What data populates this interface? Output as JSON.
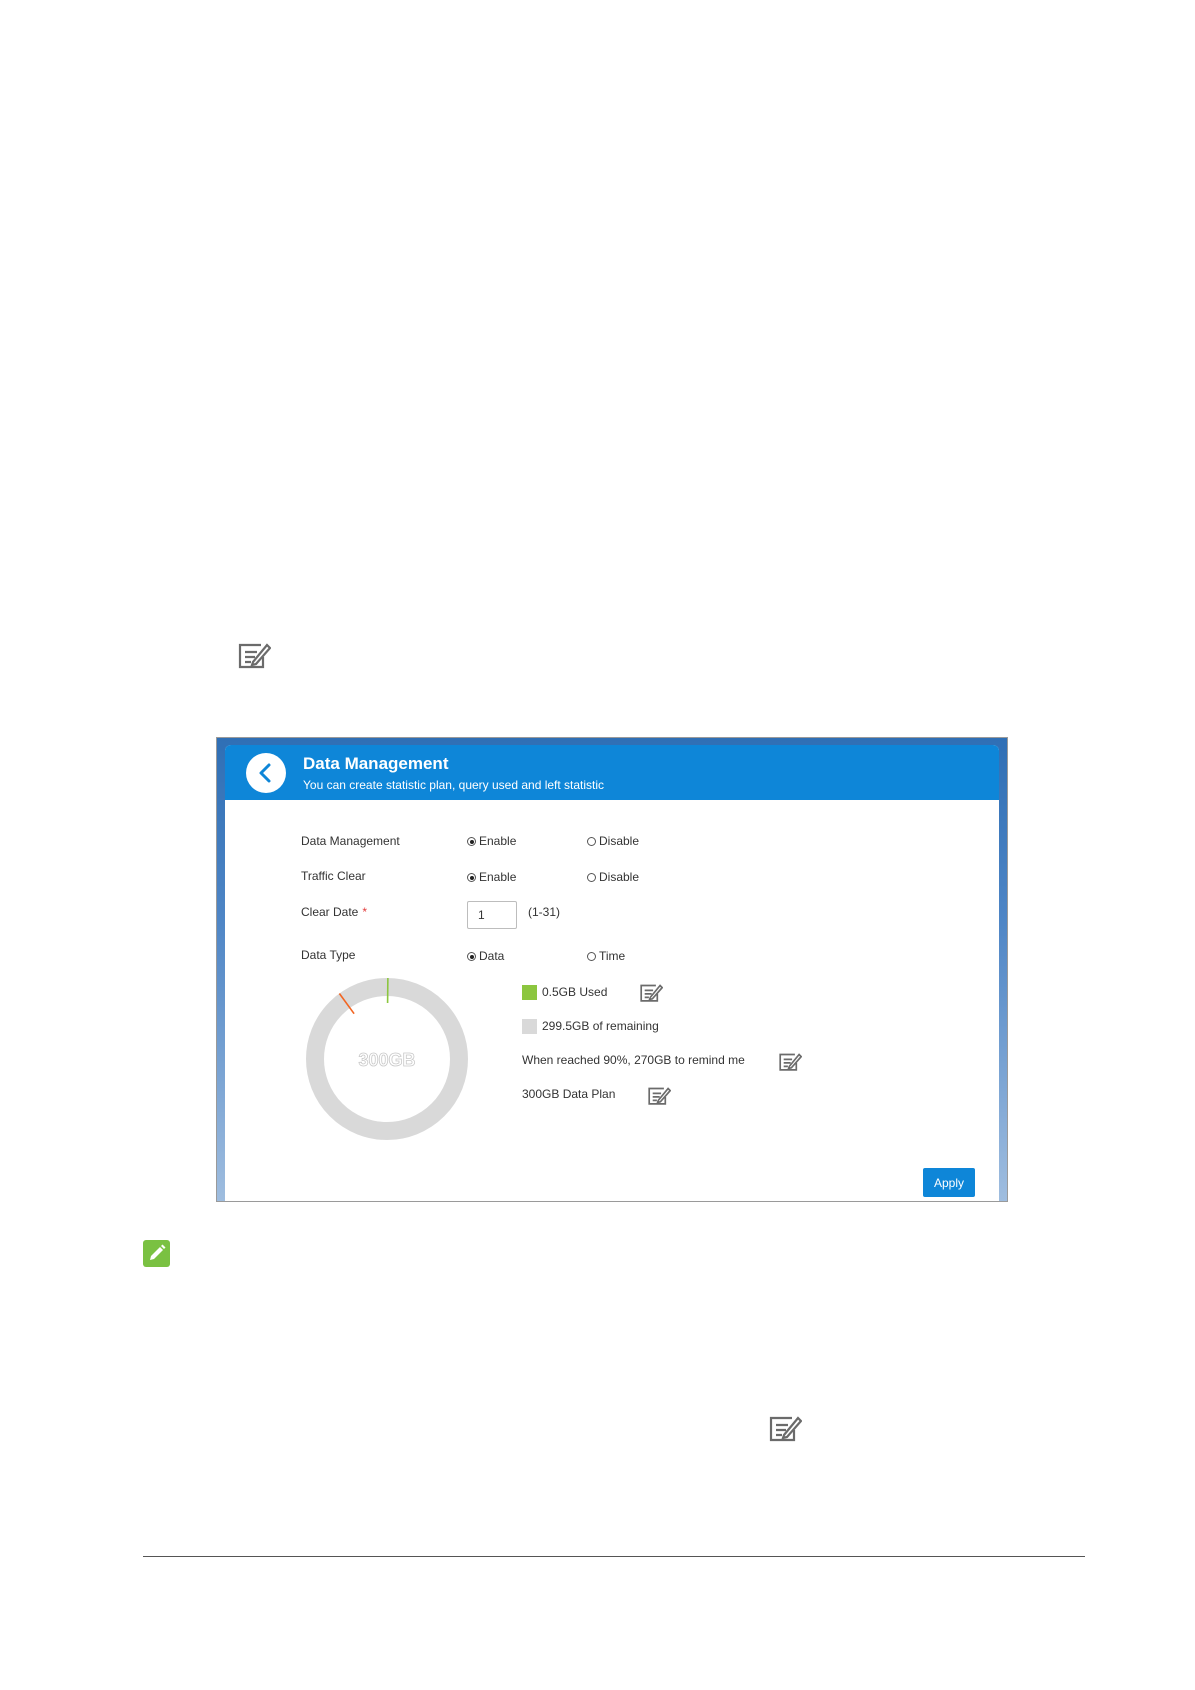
{
  "colors": {
    "header_blue": "#0e86d8",
    "used_green": "#8cc63f",
    "remaining_gray": "#d9d9d9",
    "remind_marker": "#f26522",
    "note_green": "#7ac142"
  },
  "icons": {
    "edit": "edit-note-icon",
    "note": "pencil-note-icon",
    "back": "chevron-left-icon"
  },
  "panel": {
    "title": "Data Management",
    "subtitle": "You can create statistic plan, query used and left statistic"
  },
  "form": {
    "data_management": {
      "label": "Data Management",
      "enable": "Enable",
      "disable": "Disable",
      "selected": "Enable"
    },
    "traffic_clear": {
      "label": "Traffic Clear",
      "enable": "Enable",
      "disable": "Disable",
      "selected": "Enable"
    },
    "clear_date": {
      "label": "Clear Date",
      "required_mark": "*",
      "value": "1",
      "range": "(1-31)"
    },
    "data_type": {
      "label": "Data Type",
      "option_data": "Data",
      "option_time": "Time",
      "selected": "Data"
    }
  },
  "usage": {
    "center_label": "300GB",
    "used_label": "0.5GB Used",
    "remaining_label": "299.5GB of remaining",
    "remind_label": "When reached 90%, 270GB to remind me",
    "plan_label": "300GB Data Plan",
    "used_fraction": 0.0017,
    "remind_fraction": 0.9
  },
  "buttons": {
    "apply": "Apply"
  }
}
